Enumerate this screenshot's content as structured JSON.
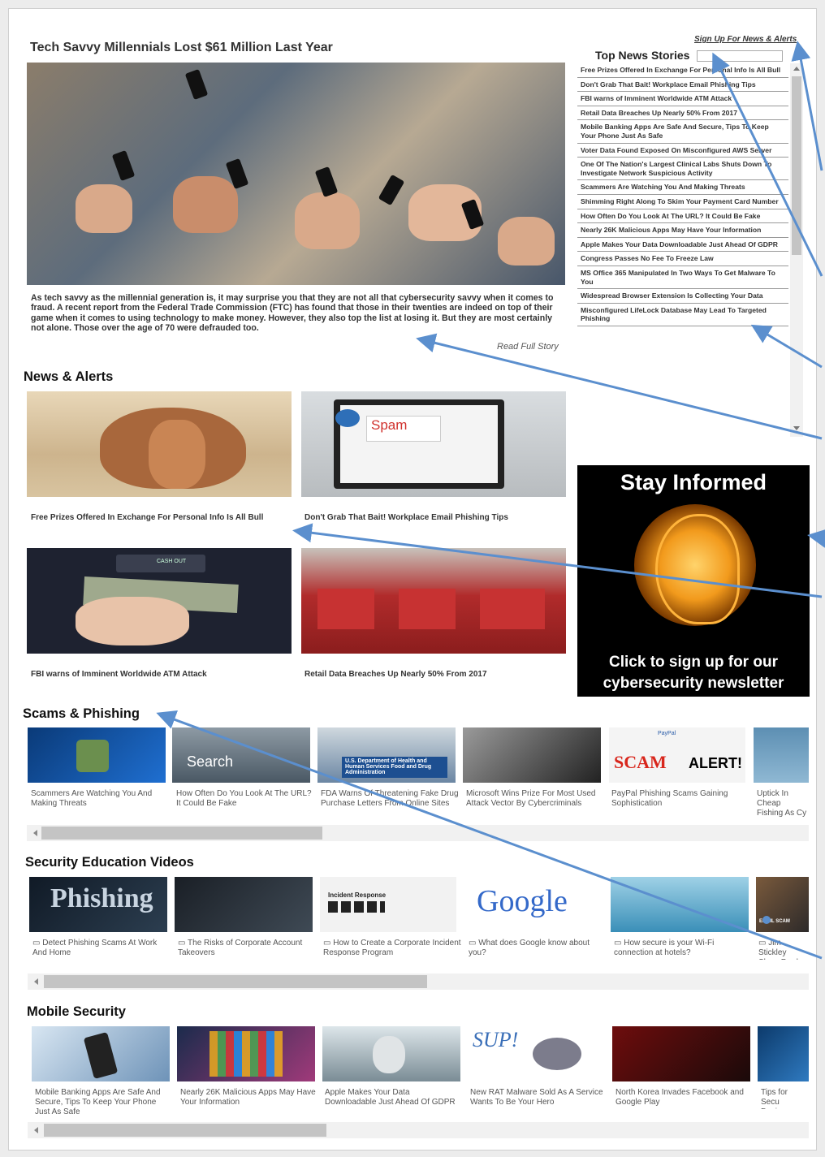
{
  "feature": {
    "title": "Tech Savvy Millennials Lost $61 Million Last Year",
    "body": "As tech savvy as the millennial generation is, it may surprise you that they are not all that cybersecurity savvy when it comes to fraud. A recent report from the Federal Trade Commission (FTC) has found that those in their twenties are indeed on top of their game when it comes to using technology to make money. However, they also top the list at losing it. But they are most certainly not alone. Those over the age of 70 were defrauded too.",
    "read_more": "Read Full Story"
  },
  "signup_link": "Sign Up For News & Alerts",
  "top_news": {
    "title": "Top News Stories",
    "items": [
      "Free Prizes Offered In Exchange For Personal Info Is All Bull",
      "Don't Grab That Bait! Workplace Email Phishing Tips",
      "FBI warns of Imminent Worldwide ATM Attack",
      "Retail Data Breaches Up Nearly 50% From 2017",
      "Mobile Banking Apps Are Safe And Secure, Tips To Keep Your Phone Just As Safe",
      "Voter Data Found Exposed On Misconfigured AWS Server",
      "One Of The Nation's Largest Clinical Labs Shuts Down To Investigate Network Suspicious Activity",
      "Scammers Are Watching You And Making Threats",
      "Shimming Right Along To Skim Your Payment Card Number",
      "How Often Do You Look At The URL? It Could Be Fake",
      "Nearly 26K Malicious Apps May Have Your Information",
      "Apple Makes Your Data Downloadable Just Ahead Of GDPR",
      "Congress Passes No Fee To Freeze Law",
      "MS Office 365 Manipulated In Two Ways To Get Malware To You",
      "Widespread Browser Extension Is Collecting Your Data",
      "Misconfigured LifeLock Database May Lead To Targeted Phishing"
    ]
  },
  "news_alerts": {
    "heading": "News & Alerts",
    "cards": [
      "Free Prizes Offered In Exchange For Personal Info Is All Bull",
      "Don't Grab That Bait! Workplace Email Phishing Tips",
      "FBI warns of Imminent Worldwide ATM Attack",
      "Retail Data Breaches Up Nearly 50% From 2017"
    ],
    "spam_label": "Spam",
    "atm_label": "CASH OUT"
  },
  "stay_informed": {
    "title": "Stay Informed",
    "cta": "Click to sign up for our cybersecurity newsletter"
  },
  "scams": {
    "heading": "Scams & Phishing",
    "items": [
      "Scammers Are Watching You And Making Threats",
      "How Often Do You Look At The URL? It Could Be Fake",
      "FDA Warns Of Threatening Fake Drug Purchase Letters From Online Sites",
      "Microsoft Wins Prize For Most Used Attack Vector By Cybercriminals",
      "PayPal Phishing Scams Gaining Sophistication",
      "Uptick In Cheap Fishing As Cy Cybersecurity"
    ],
    "img_text_search": "Search",
    "img_text_fda": "U.S. Department of Health and Human Services Food and Drug Administration",
    "img_text_scam": "SCAM",
    "img_text_alert": "ALERT!",
    "img_text_paypal": "PayPal"
  },
  "videos": {
    "heading": "Security Education Videos",
    "items": [
      "Detect Phishing Scams At Work And Home",
      "The Risks of Corporate Account Takeovers",
      "How to Create a Corporate Incident Response Program",
      "What does Google know about you?",
      "How secure is your Wi-Fi connection at hotels?",
      "Jim Stickley Show Produc"
    ],
    "img_text_phishing": "Phishing",
    "img_text_incident": "Incident Response",
    "img_text_google": "Google",
    "img_text_email": "EMAIL SCAM"
  },
  "mobile": {
    "heading": "Mobile Security",
    "items": [
      "Mobile Banking Apps Are Safe And Secure, Tips To Keep Your Phone Just As Safe",
      "Nearly 26K Malicious Apps May Have Your Information",
      "Apple Makes Your Data Downloadable Just Ahead Of GDPR",
      "New RAT Malware Sold As A Service Wants To Be Your Hero",
      "North Korea Invades Facebook and Google Play",
      "Tips for Secu Devices"
    ],
    "img_text_sup": "SUP!"
  },
  "colors": {
    "accent_arrow": "#5b8fce",
    "scrollbar_track": "#f1f1f1",
    "scrollbar_thumb": "#c4c4c4"
  }
}
